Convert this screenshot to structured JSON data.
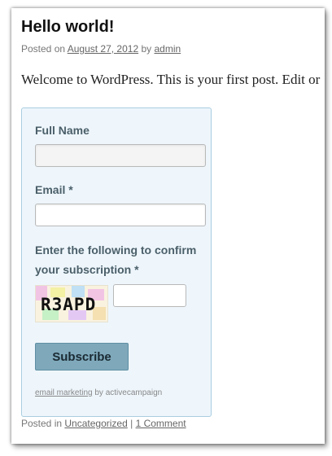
{
  "post": {
    "title": "Hello world!",
    "meta_prefix": "Posted on ",
    "date": "August 27, 2012",
    "by": " by ",
    "author": "admin",
    "body": "Welcome to WordPress. This is your first post. Edit or"
  },
  "form": {
    "full_name_label": "Full Name",
    "full_name_value": "",
    "email_label": "Email *",
    "email_value": "",
    "confirm_label": "Enter the following to confirm your subscription *",
    "captcha_text": "R3APD",
    "captcha_value": "",
    "subscribe_label": "Subscribe",
    "credit_link": "email marketing",
    "credit_suffix": " by activecampaign"
  },
  "footer": {
    "prefix": "Posted in ",
    "category": "Uncategorized",
    "separator": " | ",
    "comments": "1 Comment"
  },
  "colors": {
    "form_background": "#eef6fc",
    "form_border": "#a9cde0",
    "button_background": "#7fa9bb"
  }
}
